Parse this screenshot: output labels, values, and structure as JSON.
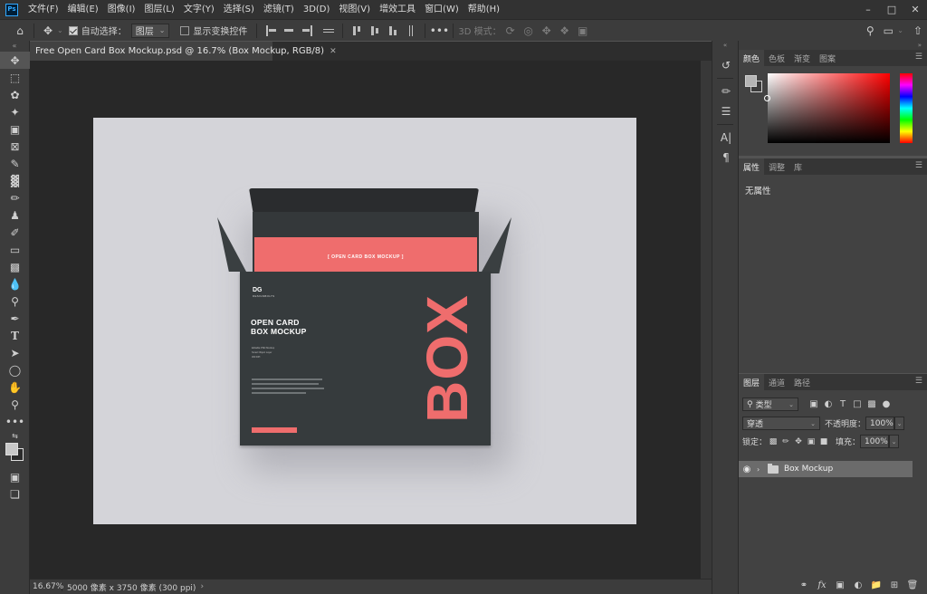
{
  "app": {
    "logo_text": "Ps"
  },
  "menu": [
    "文件(F)",
    "编辑(E)",
    "图像(I)",
    "图层(L)",
    "文字(Y)",
    "选择(S)",
    "滤镜(T)",
    "3D(D)",
    "视图(V)",
    "增效工具",
    "窗口(W)",
    "帮助(H)"
  ],
  "options": {
    "auto_select_label": "自动选择：",
    "auto_select_checked": true,
    "auto_select_target": "图层",
    "show_transform_label": "显示变换控件",
    "show_transform_checked": false,
    "mode_3d_label": "3D 模式："
  },
  "document": {
    "tab_title": "Free Open Card Box Mockup.psd @ 16.7% (Box Mockup, RGB/8)"
  },
  "mockup": {
    "card_text": "[ OPEN CARD BOX MOCKUP ]",
    "brand_logo": "DG",
    "brand_sub": "DESIGNBOLTS",
    "title_line1": "OPEN CARD",
    "title_line2": "BOX MOCKUP",
    "detail_line1": "Editable PSD Mockup",
    "detail_line2": "Smart Object Layer",
    "detail_line3": "300 DPI",
    "big_word": "BOX"
  },
  "statusbar": {
    "zoom": "16.67%",
    "doc_info": "5000 像素 x 3750 像素 (300 ppi)"
  },
  "color_panel": {
    "tabs": [
      "颜色",
      "色板",
      "渐变",
      "图案"
    ],
    "active_tab": 0,
    "foreground": "#b5b5b5",
    "background": "#3c3c3c"
  },
  "properties_panel": {
    "tabs": [
      "属性",
      "调整",
      "库"
    ],
    "active_tab": 0,
    "empty_text": "无属性"
  },
  "layers_panel": {
    "tabs": [
      "图层",
      "通道",
      "路径"
    ],
    "active_tab": 0,
    "filter_label": "类型",
    "blend_mode": "穿透",
    "opacity_label": "不透明度：",
    "opacity_value": "100%",
    "lock_label": "锁定：",
    "fill_label": "填充：",
    "fill_value": "100%",
    "layers": [
      {
        "name": "Box Mockup",
        "type": "group",
        "visible": true,
        "selected": true
      }
    ]
  }
}
